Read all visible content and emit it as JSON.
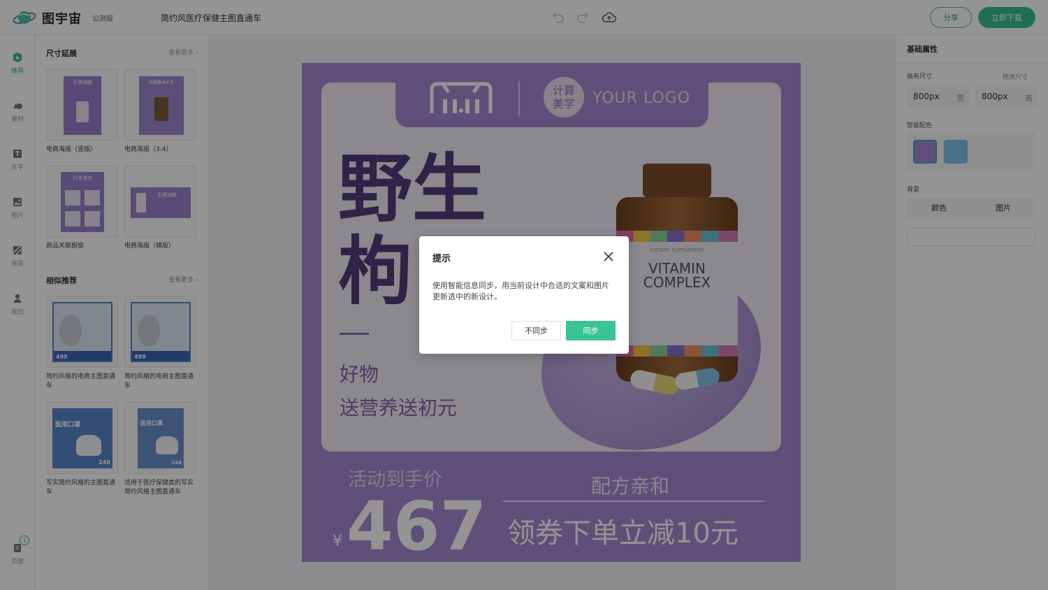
{
  "app": {
    "name": "图宇宙",
    "badge": "公测版",
    "document_title": "简约风医疗保健主图直通车"
  },
  "toolbar": {
    "undo_icon": "undo-icon",
    "redo_icon": "redo-icon",
    "cloud_icon": "cloud-upload-icon",
    "share_label": "分享",
    "download_label": "立即下载"
  },
  "rail": {
    "items": [
      {
        "label": "推荐",
        "icon": "recommend-icon"
      },
      {
        "label": "素材",
        "icon": "shapes-icon"
      },
      {
        "label": "文字",
        "icon": "text-icon"
      },
      {
        "label": "图片",
        "icon": "image-icon"
      },
      {
        "label": "背景",
        "icon": "background-icon"
      },
      {
        "label": "我的",
        "icon": "user-icon"
      }
    ],
    "pages_label": "页面",
    "pages_count": "1"
  },
  "panel": {
    "size_section": {
      "title": "尺寸延展",
      "more": "查看更多"
    },
    "size_items": [
      {
        "label": "电商海报（竖版）",
        "thumb_text": "无惧油腻"
      },
      {
        "label": "电商海报（3:4）",
        "thumb_text": "优质膳食补充"
      },
      {
        "label": "商品关联橱窗",
        "thumb_text": "月末清仓"
      },
      {
        "label": "电商海报（横版）",
        "thumb_text": "无惧油腻"
      }
    ],
    "similar_section": {
      "title": "相似推荐",
      "more": "查看更多"
    },
    "similar_items": [
      {
        "label": "简约风格的电商主图直通车",
        "price": "499"
      },
      {
        "label": "简约风格的电商主图直通车",
        "price": "499"
      },
      {
        "label": "写实简约风格的主图直通车",
        "thumb_text": "医用口罩",
        "price": "248"
      },
      {
        "label": "适用于医疗保健类的写实简约风格主图直通车",
        "thumb_text": "医用口罩",
        "price": "248"
      }
    ]
  },
  "poster": {
    "logo_circle_text": "计算美学",
    "logo_text": "YOUR LOGO",
    "headline_1": "野生",
    "headline_2": "枸",
    "sub_1": "好物",
    "sub_2": "送营养送初元",
    "bottle_small": "DIETARY SUPPLEMENT",
    "bottle_main_1": "VITAMIN",
    "bottle_main_2": "COMPLEX",
    "price_label": "活动到手价",
    "currency": "¥",
    "price": "467",
    "right_label": "配方亲和",
    "coupon": "领券下单立减10元"
  },
  "rpanel": {
    "title": "基础属性",
    "canvas_size_label": "画布尺寸",
    "modify_size": "修改尺寸",
    "width_value": "800px",
    "width_unit": "宽",
    "height_value": "800px",
    "height_unit": "高",
    "smart_color_label": "智能配色",
    "swatches": [
      "#a68ad0",
      "#7ec3e8"
    ],
    "background_label": "背景",
    "bg_tab_color": "颜色",
    "bg_tab_image": "图片"
  },
  "dialog": {
    "title": "提示",
    "body": "使用智能信息同步，用当前设计中合适的文案和图片更新选中的新设计。",
    "cancel_label": "不同步",
    "ok_label": "同步"
  }
}
